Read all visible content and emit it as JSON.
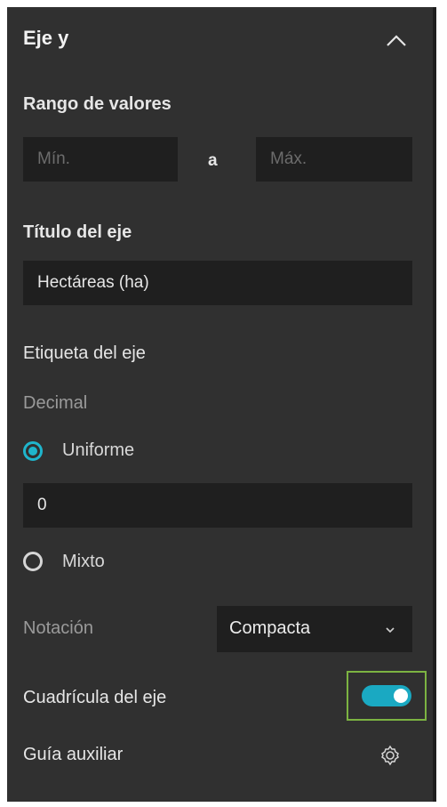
{
  "section": {
    "title": "Eje y",
    "collapse_icon": "chevron-up-icon"
  },
  "range": {
    "label": "Rango de valores",
    "min_placeholder": "Mín.",
    "min_value": "",
    "separator": "a",
    "max_placeholder": "Máx.",
    "max_value": ""
  },
  "axis_title": {
    "label": "Título del eje",
    "value": "Hectáreas (ha)"
  },
  "axis_label": {
    "label": "Etiqueta del eje",
    "decimal_label": "Decimal",
    "options": [
      {
        "label": "Uniforme",
        "selected": true
      },
      {
        "label": "Mixto",
        "selected": false
      }
    ],
    "uniform_value": "0"
  },
  "notation": {
    "label": "Notación",
    "selected": "Compacta",
    "dropdown_icon": "chevron-down-icon"
  },
  "gridlines": {
    "label": "Cuadrícula del eje",
    "enabled": true
  },
  "guide": {
    "label": "Guía auxiliar",
    "settings_icon": "gear-icon"
  },
  "colors": {
    "panel_bg": "#303030",
    "field_bg": "#1f1f1f",
    "accent": "#1fb5cc",
    "focus_outline": "#7cb342"
  }
}
